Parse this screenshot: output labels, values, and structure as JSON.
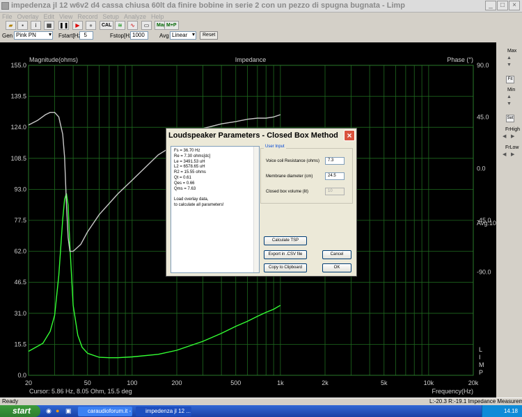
{
  "window": {
    "title": "impedenza jl 12 w6v2 d4 cassa chiusa 60lt da finire bobine in serie 2 con un pezzo di spugna bugnata - Limp"
  },
  "menu": [
    "File",
    "Overlay",
    "Edit",
    "View",
    "Record",
    "Setup",
    "Analyze",
    "Help"
  ],
  "toolbar": {
    "cal_label": "CAL",
    "mag_label": "Mag",
    "mp_label": "M+P"
  },
  "generator": {
    "gen_label": "Gen",
    "gen_value": "Pink PN",
    "fstart_label": "Fstart[Hz]",
    "fstart_value": "5",
    "fstop_label": "Fstop[Hz]",
    "fstop_value": "1000",
    "avg_label": "Avg",
    "avg_value": "Linear",
    "set_label": "Set",
    "reset_label": "Reset"
  },
  "chart_data": {
    "type": "line",
    "title": "Impedance",
    "ylabel": "Magnitude(ohms)",
    "y2label": "Phase (°)",
    "xlabel": "Frequency(Hz)",
    "xscale": "log",
    "xlim": [
      20,
      20000
    ],
    "ylim": [
      0,
      155
    ],
    "y2lim": [
      -180,
      90
    ],
    "x_ticks": [
      "20",
      "50",
      "100",
      "200",
      "500",
      "1k",
      "2k",
      "5k",
      "10k",
      "20k"
    ],
    "y_ticks": [
      "155.0",
      "139.5",
      "124.0",
      "108.5",
      "93.0",
      "77.5",
      "62.0",
      "46.5",
      "31.0",
      "15.5",
      "0.0"
    ],
    "y2_ticks": [
      "90.0",
      "45.0",
      "0.0",
      "-45.0",
      "-90.0"
    ],
    "avg_text": "Avg:10",
    "limp_text": [
      "L",
      "I",
      "M",
      "P"
    ],
    "cursor_text": "Cursor: 5.86 Hz, 8.05 Ohm, 15.5 deg",
    "grid": true,
    "series": [
      {
        "name": "Magnitude",
        "color": "#33ff33",
        "x": [
          20,
          25,
          28,
          30,
          32,
          34,
          35,
          36,
          37,
          38,
          40,
          43,
          46,
          50,
          60,
          70,
          80,
          100,
          150,
          200,
          300,
          400,
          500,
          600,
          700,
          800,
          900,
          1000
        ],
        "y": [
          12,
          16,
          22,
          30,
          50,
          78,
          88,
          91,
          85,
          65,
          35,
          20,
          14,
          11,
          9,
          8.8,
          8.8,
          9.2,
          10.5,
          12.5,
          17,
          21,
          24.5,
          27,
          29.5,
          31.5,
          33,
          35
        ]
      },
      {
        "name": "Phase",
        "color": "#c8c8c8",
        "x": [
          20,
          23,
          26,
          28,
          30,
          32,
          34,
          35,
          36,
          37,
          38,
          40,
          45,
          50,
          60,
          80,
          100,
          150,
          200,
          300,
          400,
          500,
          600,
          700,
          800,
          900,
          1000
        ],
        "y": [
          38,
          42,
          47,
          49,
          49,
          45,
          30,
          10,
          -30,
          -60,
          -72,
          -72,
          -66,
          -55,
          -40,
          -22,
          -10,
          12,
          22,
          35,
          39,
          41,
          43,
          44,
          44,
          45,
          47
        ]
      }
    ]
  },
  "right_panel": {
    "max_label": "Max",
    "fit_label": "Fit",
    "min_label": "Min",
    "set_label": "Set",
    "frhigh_label": "FrHigh",
    "frlow_label": "FrLow"
  },
  "dialog": {
    "title": "Loudspeaker Parameters - Closed Box Method",
    "results": [
      "Fs  = 36.70 Hz",
      "Re  = 7.30 ohms[dc]",
      "Le  = 3491.53 uH",
      "L2  = 6578.65 uH",
      "R2  = 15.55 ohms",
      "Qt  = 0.61",
      "Qes = 0.66",
      "Qms = 7.63",
      "",
      "Load overlay data,",
      "to calculate all parameters!"
    ],
    "group_label": "User Input",
    "vc_label": "Voice coil Resistance (ohms)",
    "vc_value": "7.3",
    "md_label": "Membrane diameter (cm)",
    "md_value": "24.5",
    "vol_label": "Closed box volume (lit)",
    "vol_value": "10",
    "calc_label": "Calculate TSP",
    "export_label": "Export in .CSV file",
    "copy_label": "Copy to Clipboard",
    "cancel_label": "Cancel",
    "ok_label": "OK"
  },
  "status": {
    "left": "Ready",
    "right": "L:-20.3  R:-19.1   Impedance Measurement"
  },
  "taskbar": {
    "start": "start",
    "task1": "caraudioforum.it - ...",
    "task2": "impedenza jl 12 ...",
    "clock": "14.18"
  }
}
